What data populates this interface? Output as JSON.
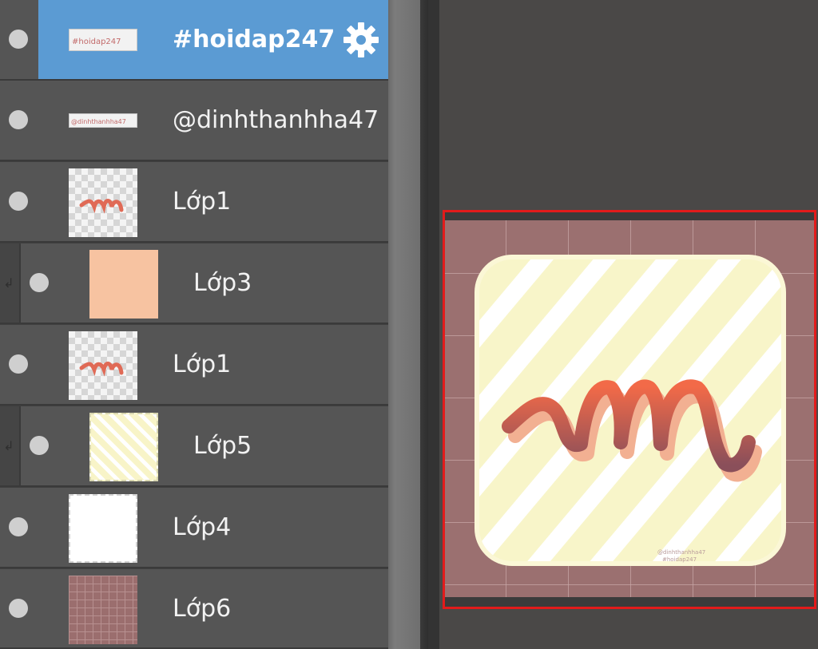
{
  "layers": [
    {
      "name": "#hoidap247",
      "selected": true,
      "clipped": false,
      "thumb": "text",
      "thumb_text": "#hoidap247"
    },
    {
      "name": "@dinhthanhha47",
      "selected": false,
      "clipped": false,
      "thumb": "text-small",
      "thumb_text": "@dinhthanhha47"
    },
    {
      "name": "Lớp1",
      "selected": false,
      "clipped": false,
      "thumb": "art"
    },
    {
      "name": "Lớp3",
      "selected": false,
      "clipped": true,
      "thumb": "peach"
    },
    {
      "name": "Lớp1",
      "selected": false,
      "clipped": false,
      "thumb": "art"
    },
    {
      "name": "Lớp5",
      "selected": false,
      "clipped": true,
      "thumb": "stripes"
    },
    {
      "name": "Lớp4",
      "selected": false,
      "clipped": false,
      "thumb": "white"
    },
    {
      "name": "Lớp6",
      "selected": false,
      "clipped": false,
      "thumb": "mauve"
    }
  ],
  "canvas": {
    "watermark_line1": "@dinhthanhha47",
    "watermark_line2": "#hoidap247"
  },
  "colors": {
    "selection": "#5b9bd3",
    "row": "#555555",
    "canvas_border": "#e21b1b",
    "background_mauve": "#9b7070",
    "card_cream": "#f8f5c9",
    "stroke_orange": "#f06a48"
  },
  "icons": {
    "visibility": "eye-dot-icon",
    "settings": "gear-icon",
    "clip": "clip-arrow-icon"
  }
}
